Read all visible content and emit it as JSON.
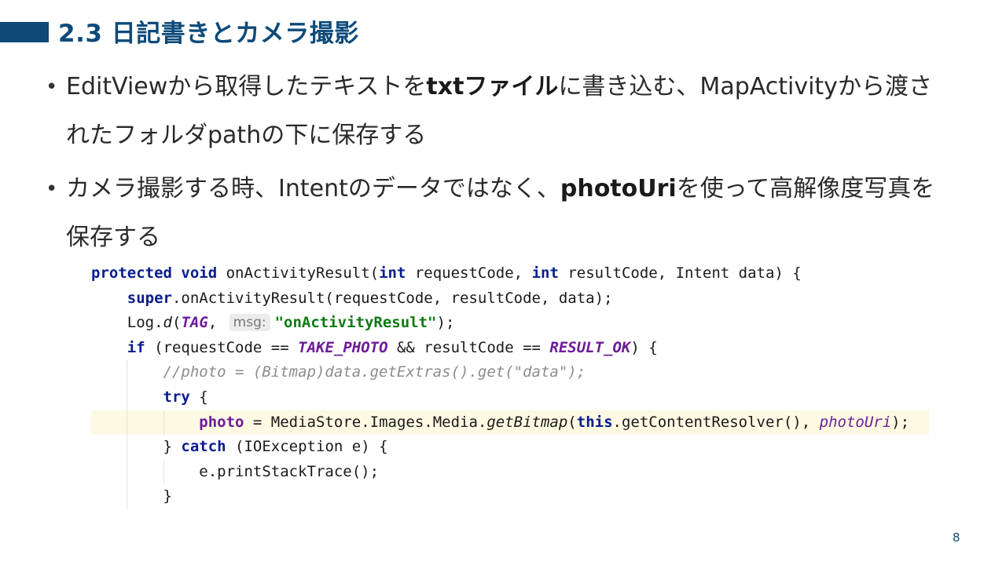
{
  "slide": {
    "section_title": "2.3 日記書きとカメラ撮影",
    "page_number": "8"
  },
  "bullets": [
    {
      "parts": [
        "EditViewから取得したテキストを",
        "txtファイル",
        "に書き込む、MapActivityから渡さ"
      ],
      "line2": "れたフォルダpathの下に保存する"
    },
    {
      "parts": [
        "カメラ撮影する時、Intentのデータではなく、",
        "photoUri",
        "を使って高解像度写真を"
      ],
      "line2": "保存する"
    }
  ],
  "code": {
    "l1": {
      "kw1": "protected",
      "kw2": "void",
      "a": " onActivityResult(",
      "kw3": "int",
      "b": " requestCode, ",
      "kw4": "int",
      "c": " resultCode, Intent data) {"
    },
    "l2": {
      "kw": "super",
      "a": ".onActivityResult(requestCode, resultCode, data);"
    },
    "l3": {
      "a": "Log.",
      "fn": "d",
      "b": "(",
      "tag": "TAG",
      "c": ", ",
      "hint": "msg:",
      "str": "\"onActivityResult\"",
      "d": ");"
    },
    "l4": {
      "kw": "if",
      "a": " (requestCode == ",
      "f1": "TAKE_PHOTO",
      "b": " && resultCode == ",
      "f2": "RESULT_OK",
      "c": ") {"
    },
    "l5": {
      "cmt": "//photo = (Bitmap)data.getExtras().get(\"data\");"
    },
    "l6": {
      "kw": "try",
      "a": " {"
    },
    "l7": {
      "field": "photo",
      "a": " = MediaStore.Images.Media.",
      "fn": "getBitmap",
      "b": "(",
      "kw": "this",
      "c": ".getContentResolver(), ",
      "uri": "photoUri",
      "d": ");"
    },
    "l8": {
      "a": "} ",
      "kw": "catch",
      "b": " (IOException e) {"
    },
    "l9": {
      "a": "e.printStackTrace();"
    },
    "l10": {
      "a": "}"
    }
  }
}
